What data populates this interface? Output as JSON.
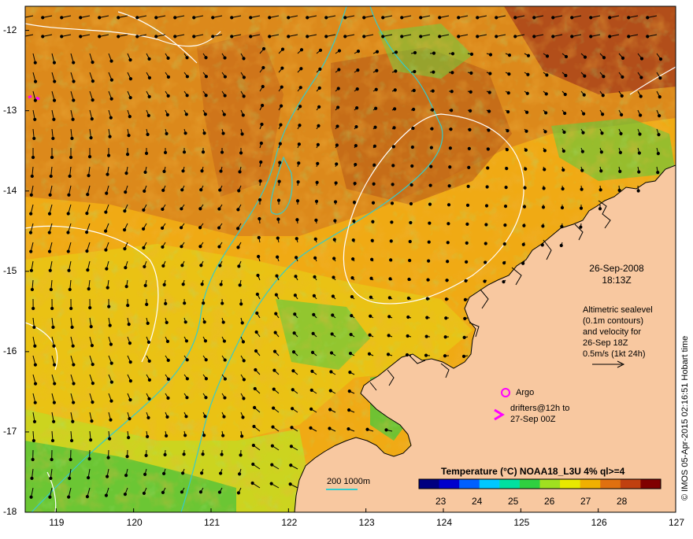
{
  "map": {
    "longitude_ticks": [
      "119",
      "120",
      "121",
      "122",
      "123",
      "124",
      "125",
      "126",
      "127"
    ],
    "latitude_ticks": [
      "-12",
      "-13",
      "-14",
      "-15",
      "-16",
      "-17",
      "-18"
    ],
    "lon_range": [
      118.6,
      127.0
    ],
    "lat_range": [
      -18.0,
      -11.7
    ]
  },
  "annotation": {
    "date": "26-Sep-2008",
    "time": "18:13Z",
    "description_lines": [
      "Altimetric sealevel",
      "(0.1m contours)",
      "and velocity for",
      "26-Sep 18Z"
    ],
    "velocity_scale": "0.5m/s (1kt 24h)"
  },
  "markers": {
    "argo_label": "Argo",
    "drifters_lines": [
      "drifters@12h to",
      "27-Sep 00Z"
    ],
    "marker_color": "#ff00ff"
  },
  "bathymetry_legend": {
    "label": "200  1000m",
    "line_color": "#33cccc"
  },
  "colorbar": {
    "title": "Temperature (°C) NOAA18_L3U 4% ql>=4",
    "ticks": [
      "23",
      "24",
      "25",
      "26",
      "27",
      "28"
    ],
    "colors": [
      "#000080",
      "#0000cc",
      "#0060ff",
      "#00c8ff",
      "#00e0a0",
      "#30d040",
      "#a0e020",
      "#e8e800",
      "#f0b000",
      "#e07010",
      "#c04010",
      "#800000"
    ]
  },
  "credit": "© IMOS 05-Apr-2015 02:16:51 Hobart time",
  "colors": {
    "land": "#f8c8a0",
    "sea_warm": "#d9861a",
    "sea_mid": "#f2b012",
    "sea_cool": "#e8dc16",
    "sea_cold": "#5cc83a",
    "coast": "#000000",
    "contour": "#ffffff"
  }
}
